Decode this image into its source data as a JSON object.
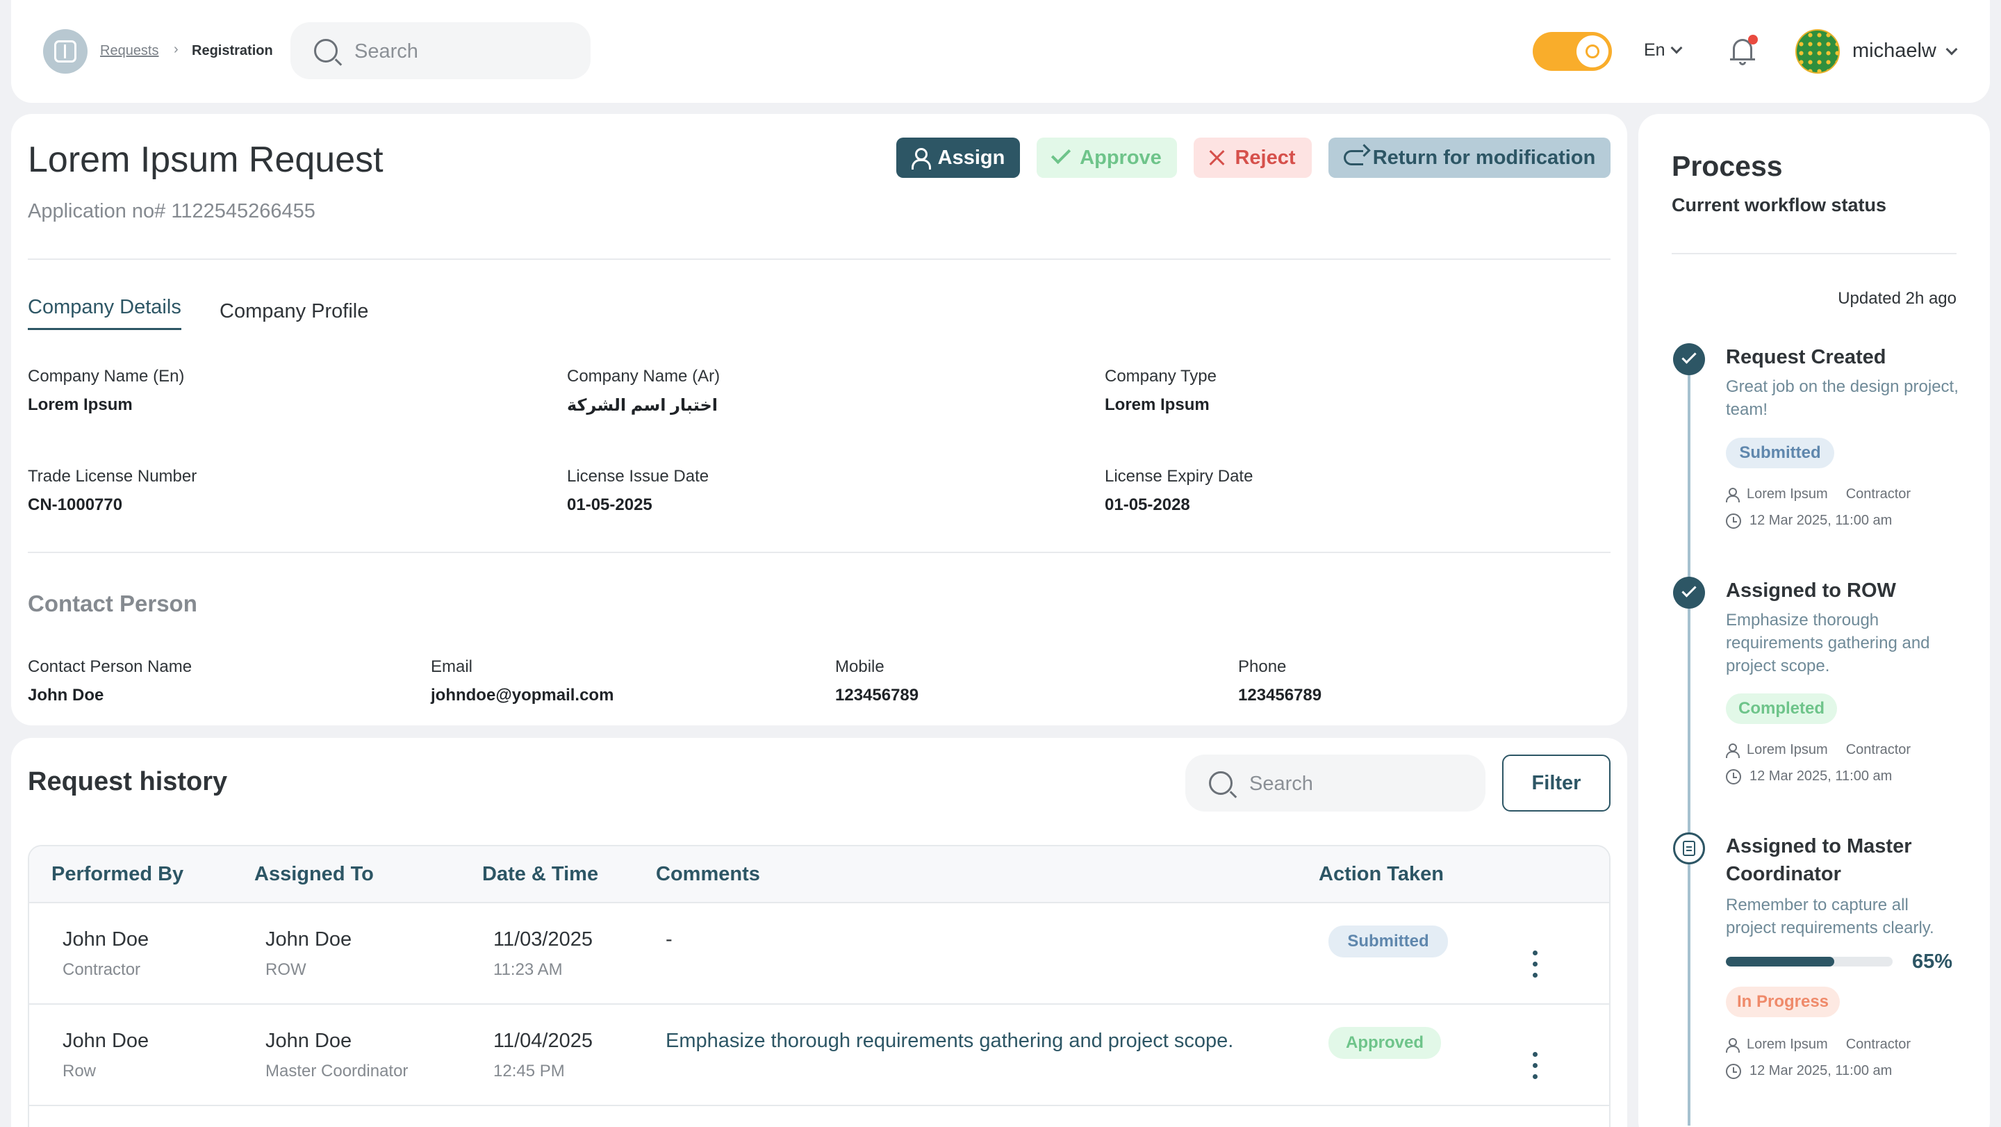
{
  "topbar": {
    "breadcrumb_parent": "Requests",
    "breadcrumb_separator": "›",
    "breadcrumb_current": "Registration",
    "search_placeholder": "Search",
    "language": "En",
    "username": "michaelw"
  },
  "request": {
    "title": "Lorem Ipsum Request",
    "application_no": "Application no# 1122545266455",
    "actions": {
      "assign": "Assign",
      "approve": "Approve",
      "reject": "Reject",
      "return": "Return for modification"
    },
    "tabs": [
      "Company Details",
      "Company Profile"
    ],
    "company": {
      "name_en_label": "Company Name (En)",
      "name_en_value": "Lorem Ipsum",
      "name_ar_label": "Company Name (Ar)",
      "name_ar_value": "اختبار اسم الشركة",
      "type_label": "Company Type",
      "type_value": "Lorem Ipsum",
      "license_no_label": "Trade License Number",
      "license_no_value": "CN-1000770",
      "issue_label": "License Issue Date",
      "issue_value": "01-05-2025",
      "expiry_label": "License Expiry Date",
      "expiry_value": "01-05-2028"
    },
    "contact": {
      "section_title": "Contact Person",
      "name_label": "Contact Person Name",
      "name_value": "John Doe",
      "email_label": "Email",
      "email_value": "johndoe@yopmail.com",
      "mobile_label": "Mobile",
      "mobile_value": "123456789",
      "phone_label": "Phone",
      "phone_value": "123456789"
    }
  },
  "history": {
    "title": "Request history",
    "search_placeholder": "Search",
    "filter_label": "Filter",
    "columns": [
      "Performed By",
      "Assigned To",
      "Date & Time",
      "Comments",
      "Action Taken"
    ],
    "rows": [
      {
        "performed_by": "John Doe",
        "performed_role": "Contractor",
        "assigned_to": "John Doe",
        "assigned_role": "ROW",
        "date": "11/03/2025",
        "time": "11:23 AM",
        "comment": "-",
        "action": "Submitted"
      },
      {
        "performed_by": "John Doe",
        "performed_role": "Row",
        "assigned_to": "John Doe",
        "assigned_role": "Master Coordinator",
        "date": "11/04/2025",
        "time": "12:45 PM",
        "comment": "Emphasize thorough requirements gathering and project scope.",
        "action": "Approved"
      }
    ]
  },
  "process": {
    "title": "Process",
    "subtitle": "Current workflow status",
    "updated": "Updated 2h ago",
    "steps": [
      {
        "title": "Request Created",
        "description": "Great job on the design project, team!",
        "status": "Submitted",
        "user": "Lorem Ipsum",
        "role": "Contractor",
        "datetime": "12 Mar 2025, 11:00 am"
      },
      {
        "title": "Assigned to ROW",
        "description": "Emphasize thorough requirements gathering and project scope.",
        "status": "Completed",
        "user": "Lorem Ipsum",
        "role": "Contractor",
        "datetime": "12 Mar 2025, 11:00 am"
      },
      {
        "title": "Assigned to Master Coordinator",
        "description": "Remember to capture all project requirements clearly.",
        "progress": 65,
        "progress_label": "65%",
        "status": "In Progress",
        "user": "Lorem Ipsum",
        "role": "Contractor",
        "datetime": "12 Mar 2025, 11:00 am"
      }
    ]
  },
  "colors": {
    "primary": "#2d5665",
    "toggle": "#f9ad2b",
    "approve_bg": "#e2f8e8",
    "reject_bg": "#fde3e2",
    "return_bg": "#b6ccd8"
  }
}
